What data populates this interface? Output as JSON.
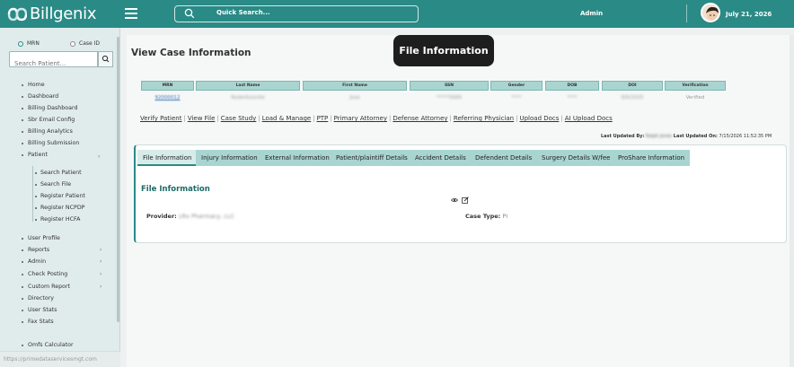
{
  "app": {
    "name": "Billgenix"
  },
  "header": {
    "search_label": "Quick Search...",
    "user": "Admin",
    "date": "July 21, 2026"
  },
  "sidebar": {
    "radio_mrn": "MRN",
    "radio_case": "Case ID",
    "search_placeholder": "Search Patient...",
    "items": [
      {
        "label": "Home"
      },
      {
        "label": "Dashboard"
      },
      {
        "label": "Billing Dashboard"
      },
      {
        "label": "Sbr Email Config"
      },
      {
        "label": "Billing Analytics"
      },
      {
        "label": "Billing Submission"
      },
      {
        "label": "Patient"
      },
      {
        "label": "Search Patient"
      },
      {
        "label": "Search File"
      },
      {
        "label": "Register Patient"
      },
      {
        "label": "Register NCPDP"
      },
      {
        "label": "Register HCFA"
      },
      {
        "label": "User Profile"
      },
      {
        "label": "Reports"
      },
      {
        "label": "Admin"
      },
      {
        "label": "Check Posting"
      },
      {
        "label": "Custom Report"
      },
      {
        "label": "Directory"
      },
      {
        "label": "User Stats"
      },
      {
        "label": "Fax Stats"
      },
      {
        "label": "Omfs Calculator"
      }
    ],
    "footer_url": "https://primedataservicesmgt.com"
  },
  "main": {
    "title": "View Case Information",
    "tooltip": "File Information",
    "table": {
      "headers": [
        "MRN",
        "Last Name",
        "First Name",
        "SSN",
        "Gender",
        "DOB",
        "DOI",
        "Verification"
      ],
      "values": [
        "92000012",
        "Roderiksonite",
        "Jose",
        "*****5689",
        "****",
        "****",
        "8/6/2025",
        "Verified"
      ]
    },
    "links": [
      "Verify Patient",
      "View File",
      "Case Study",
      "Load & Manage",
      "PTP",
      "Primary Attorney",
      "Defense Attorney",
      "Referring Physician",
      "Upload Docs",
      "AI Upload Docs"
    ],
    "updated": {
      "by_label": "Last Updated By:",
      "by_value": "Ralph Jones",
      "on_label": "Last Updated On:",
      "on_value": "7/15/2026 11:52:35 PM"
    },
    "tabs": [
      "File Information",
      "Injury Information",
      "External Information",
      "Patient/plaintiff Details",
      "Accident Details",
      "Defendent Details",
      "Surgery Details W/fee",
      "ProShare Information"
    ],
    "section": {
      "title": "File Information",
      "provider_label": "Provider:",
      "provider_value": "LRx Pharmacy, LLC",
      "case_type_label": "Case Type:",
      "case_type_value": "PI"
    }
  }
}
